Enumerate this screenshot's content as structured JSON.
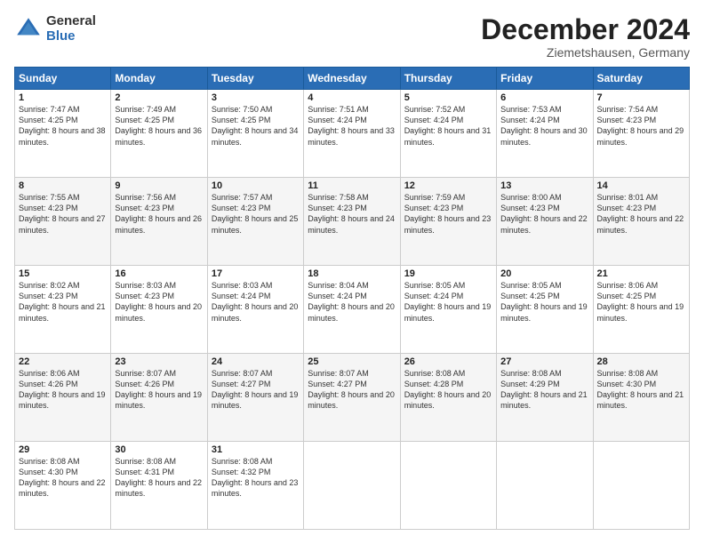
{
  "logo": {
    "general": "General",
    "blue": "Blue"
  },
  "title": "December 2024",
  "location": "Ziemetshausen, Germany",
  "days_of_week": [
    "Sunday",
    "Monday",
    "Tuesday",
    "Wednesday",
    "Thursday",
    "Friday",
    "Saturday"
  ],
  "weeks": [
    [
      {
        "day": "1",
        "sunrise": "7:47 AM",
        "sunset": "4:25 PM",
        "daylight": "8 hours and 38 minutes."
      },
      {
        "day": "2",
        "sunrise": "7:49 AM",
        "sunset": "4:25 PM",
        "daylight": "8 hours and 36 minutes."
      },
      {
        "day": "3",
        "sunrise": "7:50 AM",
        "sunset": "4:25 PM",
        "daylight": "8 hours and 34 minutes."
      },
      {
        "day": "4",
        "sunrise": "7:51 AM",
        "sunset": "4:24 PM",
        "daylight": "8 hours and 33 minutes."
      },
      {
        "day": "5",
        "sunrise": "7:52 AM",
        "sunset": "4:24 PM",
        "daylight": "8 hours and 31 minutes."
      },
      {
        "day": "6",
        "sunrise": "7:53 AM",
        "sunset": "4:24 PM",
        "daylight": "8 hours and 30 minutes."
      },
      {
        "day": "7",
        "sunrise": "7:54 AM",
        "sunset": "4:23 PM",
        "daylight": "8 hours and 29 minutes."
      }
    ],
    [
      {
        "day": "8",
        "sunrise": "7:55 AM",
        "sunset": "4:23 PM",
        "daylight": "8 hours and 27 minutes."
      },
      {
        "day": "9",
        "sunrise": "7:56 AM",
        "sunset": "4:23 PM",
        "daylight": "8 hours and 26 minutes."
      },
      {
        "day": "10",
        "sunrise": "7:57 AM",
        "sunset": "4:23 PM",
        "daylight": "8 hours and 25 minutes."
      },
      {
        "day": "11",
        "sunrise": "7:58 AM",
        "sunset": "4:23 PM",
        "daylight": "8 hours and 24 minutes."
      },
      {
        "day": "12",
        "sunrise": "7:59 AM",
        "sunset": "4:23 PM",
        "daylight": "8 hours and 23 minutes."
      },
      {
        "day": "13",
        "sunrise": "8:00 AM",
        "sunset": "4:23 PM",
        "daylight": "8 hours and 22 minutes."
      },
      {
        "day": "14",
        "sunrise": "8:01 AM",
        "sunset": "4:23 PM",
        "daylight": "8 hours and 22 minutes."
      }
    ],
    [
      {
        "day": "15",
        "sunrise": "8:02 AM",
        "sunset": "4:23 PM",
        "daylight": "8 hours and 21 minutes."
      },
      {
        "day": "16",
        "sunrise": "8:03 AM",
        "sunset": "4:23 PM",
        "daylight": "8 hours and 20 minutes."
      },
      {
        "day": "17",
        "sunrise": "8:03 AM",
        "sunset": "4:24 PM",
        "daylight": "8 hours and 20 minutes."
      },
      {
        "day": "18",
        "sunrise": "8:04 AM",
        "sunset": "4:24 PM",
        "daylight": "8 hours and 20 minutes."
      },
      {
        "day": "19",
        "sunrise": "8:05 AM",
        "sunset": "4:24 PM",
        "daylight": "8 hours and 19 minutes."
      },
      {
        "day": "20",
        "sunrise": "8:05 AM",
        "sunset": "4:25 PM",
        "daylight": "8 hours and 19 minutes."
      },
      {
        "day": "21",
        "sunrise": "8:06 AM",
        "sunset": "4:25 PM",
        "daylight": "8 hours and 19 minutes."
      }
    ],
    [
      {
        "day": "22",
        "sunrise": "8:06 AM",
        "sunset": "4:26 PM",
        "daylight": "8 hours and 19 minutes."
      },
      {
        "day": "23",
        "sunrise": "8:07 AM",
        "sunset": "4:26 PM",
        "daylight": "8 hours and 19 minutes."
      },
      {
        "day": "24",
        "sunrise": "8:07 AM",
        "sunset": "4:27 PM",
        "daylight": "8 hours and 19 minutes."
      },
      {
        "day": "25",
        "sunrise": "8:07 AM",
        "sunset": "4:27 PM",
        "daylight": "8 hours and 20 minutes."
      },
      {
        "day": "26",
        "sunrise": "8:08 AM",
        "sunset": "4:28 PM",
        "daylight": "8 hours and 20 minutes."
      },
      {
        "day": "27",
        "sunrise": "8:08 AM",
        "sunset": "4:29 PM",
        "daylight": "8 hours and 21 minutes."
      },
      {
        "day": "28",
        "sunrise": "8:08 AM",
        "sunset": "4:30 PM",
        "daylight": "8 hours and 21 minutes."
      }
    ],
    [
      {
        "day": "29",
        "sunrise": "8:08 AM",
        "sunset": "4:30 PM",
        "daylight": "8 hours and 22 minutes."
      },
      {
        "day": "30",
        "sunrise": "8:08 AM",
        "sunset": "4:31 PM",
        "daylight": "8 hours and 22 minutes."
      },
      {
        "day": "31",
        "sunrise": "8:08 AM",
        "sunset": "4:32 PM",
        "daylight": "8 hours and 23 minutes."
      },
      null,
      null,
      null,
      null
    ]
  ],
  "labels": {
    "sunrise": "Sunrise:",
    "sunset": "Sunset:",
    "daylight": "Daylight:"
  }
}
